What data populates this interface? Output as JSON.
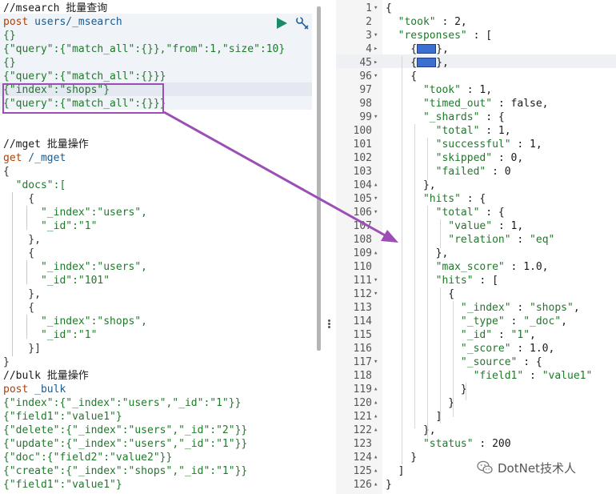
{
  "left_editor": {
    "lines": [
      {
        "kind": "comment",
        "text": "//msearch 批量查询"
      },
      {
        "kind": "request",
        "method": "post",
        "url": " users/_msearch"
      },
      {
        "kind": "json",
        "text": "{}"
      },
      {
        "kind": "json",
        "text": "{\"query\":{\"match_all\":{}},\"from\":1,\"size\":10}"
      },
      {
        "kind": "json",
        "text": "{}"
      },
      {
        "kind": "json",
        "text": "{\"query\":{\"match_all\":{}}}"
      },
      {
        "kind": "json",
        "text": "{\"index\":\"shops\"}"
      },
      {
        "kind": "json",
        "text": "{\"query\":{\"match_all\":{}}}"
      },
      {
        "kind": "blank",
        "text": ""
      },
      {
        "kind": "blank",
        "text": ""
      },
      {
        "kind": "comment",
        "text": "//mget 批量操作"
      },
      {
        "kind": "request",
        "method": "get",
        "url": " /_mget"
      },
      {
        "kind": "brace",
        "text": "{"
      },
      {
        "kind": "json",
        "text": "  \"docs\":["
      },
      {
        "kind": "brace",
        "text": "    {"
      },
      {
        "kind": "json",
        "text": "      \"_index\":\"users\","
      },
      {
        "kind": "json",
        "text": "      \"_id\":\"1\""
      },
      {
        "kind": "brace",
        "text": "    },"
      },
      {
        "kind": "brace",
        "text": "    {"
      },
      {
        "kind": "json",
        "text": "      \"_index\":\"users\","
      },
      {
        "kind": "json",
        "text": "      \"_id\":\"101\""
      },
      {
        "kind": "brace",
        "text": "    },"
      },
      {
        "kind": "brace",
        "text": "    {"
      },
      {
        "kind": "json",
        "text": "      \"_index\":\"shops\","
      },
      {
        "kind": "json",
        "text": "      \"_id\":\"1\""
      },
      {
        "kind": "brace",
        "text": "    }]"
      },
      {
        "kind": "brace",
        "text": "}"
      },
      {
        "kind": "comment",
        "text": "//bulk 批量操作"
      },
      {
        "kind": "request",
        "method": "post",
        "url": " _bulk"
      },
      {
        "kind": "json",
        "text": "{\"index\":{\"_index\":\"users\",\"_id\":\"1\"}}"
      },
      {
        "kind": "json",
        "text": "{\"field1\":\"value1\"}"
      },
      {
        "kind": "json",
        "text": "{\"delete\":{\"_index\":\"users\",\"_id\":\"2\"}}"
      },
      {
        "kind": "json",
        "text": "{\"update\":{\"_index\":\"users\",\"_id\":\"1\"}}"
      },
      {
        "kind": "json",
        "text": "{\"doc\":{\"field2\":\"value2\"}}"
      },
      {
        "kind": "json",
        "text": "{\"create\":{\"_index\":\"shops\",\"_id\":\"1\"}}"
      },
      {
        "kind": "json",
        "text": "{\"field1\":\"value1\"}"
      }
    ],
    "run_icon": "play-icon",
    "settings_icon": "wrench-icon"
  },
  "right_panel": {
    "lines": [
      {
        "num": "1",
        "fold": "▾",
        "text": "{"
      },
      {
        "num": "2",
        "fold": "",
        "text": "  \"took\" : 2,"
      },
      {
        "num": "3",
        "fold": "▾",
        "text": "  \"responses\" : ["
      },
      {
        "num": "4",
        "fold": "▸",
        "text": "    {",
        "badge": true,
        "after": "},"
      },
      {
        "num": "45",
        "fold": "▸",
        "text": "    {",
        "badge": true,
        "after": "},"
      },
      {
        "num": "96",
        "fold": "▾",
        "text": "    {"
      },
      {
        "num": "97",
        "fold": "",
        "text": "      \"took\" : 1,"
      },
      {
        "num": "98",
        "fold": "",
        "text": "      \"timed_out\" : false,"
      },
      {
        "num": "99",
        "fold": "▾",
        "text": "      \"_shards\" : {"
      },
      {
        "num": "100",
        "fold": "",
        "text": "        \"total\" : 1,"
      },
      {
        "num": "101",
        "fold": "",
        "text": "        \"successful\" : 1,"
      },
      {
        "num": "102",
        "fold": "",
        "text": "        \"skipped\" : 0,"
      },
      {
        "num": "103",
        "fold": "",
        "text": "        \"failed\" : 0"
      },
      {
        "num": "104",
        "fold": "▴",
        "text": "      },"
      },
      {
        "num": "105",
        "fold": "▾",
        "text": "      \"hits\" : {"
      },
      {
        "num": "106",
        "fold": "▾",
        "text": "        \"total\" : {"
      },
      {
        "num": "107",
        "fold": "",
        "text": "          \"value\" : 1,"
      },
      {
        "num": "108",
        "fold": "",
        "text": "          \"relation\" : \"eq\""
      },
      {
        "num": "109",
        "fold": "▴",
        "text": "        },"
      },
      {
        "num": "110",
        "fold": "",
        "text": "        \"max_score\" : 1.0,"
      },
      {
        "num": "111",
        "fold": "▾",
        "text": "        \"hits\" : ["
      },
      {
        "num": "112",
        "fold": "▾",
        "text": "          {"
      },
      {
        "num": "113",
        "fold": "",
        "text": "            \"_index\" : \"shops\","
      },
      {
        "num": "114",
        "fold": "",
        "text": "            \"_type\" : \"_doc\","
      },
      {
        "num": "115",
        "fold": "",
        "text": "            \"_id\" : \"1\","
      },
      {
        "num": "116",
        "fold": "",
        "text": "            \"_score\" : 1.0,"
      },
      {
        "num": "117",
        "fold": "▾",
        "text": "            \"_source\" : {"
      },
      {
        "num": "118",
        "fold": "",
        "text": "              \"field1\" : \"value1\""
      },
      {
        "num": "119",
        "fold": "▴",
        "text": "            }"
      },
      {
        "num": "120",
        "fold": "▴",
        "text": "          }"
      },
      {
        "num": "121",
        "fold": "▴",
        "text": "        ]"
      },
      {
        "num": "122",
        "fold": "▴",
        "text": "      },"
      },
      {
        "num": "123",
        "fold": "",
        "text": "      \"status\" : 200"
      },
      {
        "num": "124",
        "fold": "▴",
        "text": "    }"
      },
      {
        "num": "125",
        "fold": "▴",
        "text": "  ]"
      },
      {
        "num": "126",
        "fold": "▴",
        "text": "}"
      }
    ]
  },
  "watermark": {
    "text": "DotNet技术人",
    "icon": "wechat-icon"
  },
  "colors": {
    "method": "#b53f00",
    "json": "#20792b",
    "highlight_box": "#9b4fb4",
    "arrow": "#9b4fb4",
    "fold_badge": "#3d6fd1"
  }
}
